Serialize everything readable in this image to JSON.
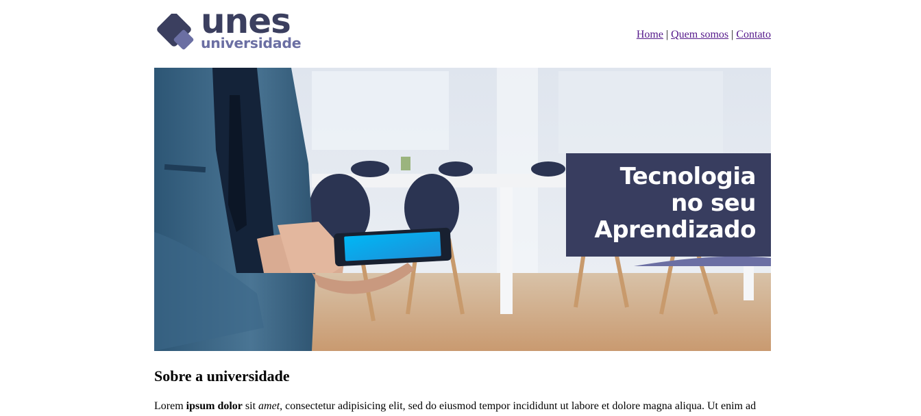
{
  "logo": {
    "title": "unes",
    "subtitle": "universidade",
    "colors": {
      "primary": "#3b3f5f",
      "accent": "#6b6fa3"
    }
  },
  "nav": {
    "home": "Home",
    "separator": "|",
    "about": "Quem somos",
    "contact": "Contato"
  },
  "banner": {
    "line1": "Tecnologia",
    "line2": "no seu",
    "line3": "Aprendizado",
    "box_color": "#383d5f"
  },
  "main": {
    "heading": "Sobre a universidade",
    "p1": "Lorem ",
    "p1_bold": "ipsum dolor",
    "p1_b": " sit ",
    "p1_italic": "amet",
    "p1_c": ", consectetur adipisicing elit, sed do eiusmod tempor incididunt ut labore et dolore magna aliqua. Ut enim ad"
  }
}
